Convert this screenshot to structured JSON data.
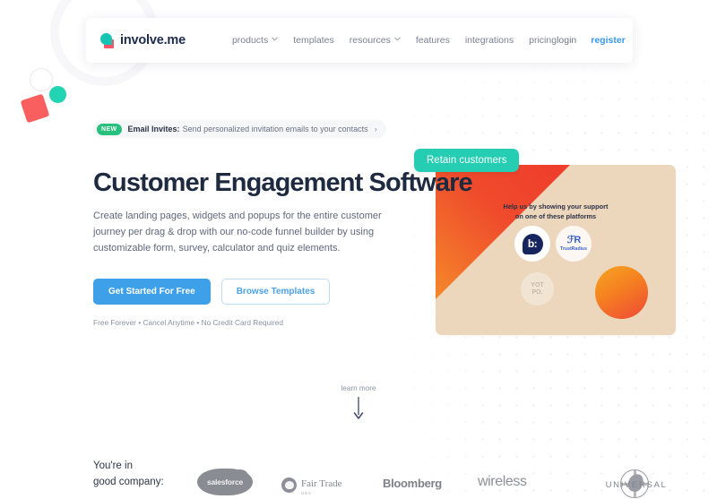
{
  "brand": {
    "name": "involve.me",
    "accent_blue": "#3ea0e8",
    "accent_teal": "#25cdb2",
    "accent_green": "#27c07d",
    "accent_red": "#fa5f5f",
    "heading_color": "#1e2a40"
  },
  "nav": {
    "links": [
      {
        "label": "products",
        "has_caret": true,
        "icon": "chevron-down-icon"
      },
      {
        "label": "templates",
        "has_caret": false
      },
      {
        "label": "resources",
        "has_caret": true,
        "icon": "chevron-down-icon"
      },
      {
        "label": "features",
        "has_caret": false
      },
      {
        "label": "integrations",
        "has_caret": false
      },
      {
        "label": "pricing",
        "has_caret": false
      }
    ],
    "login": "login",
    "register": "register"
  },
  "announcement": {
    "badge": "NEW",
    "strong": "Email Invites:",
    "text": "Send personalized invitation emails to your contacts",
    "arrow": "›"
  },
  "hero": {
    "title": "Customer Engagement Software",
    "subtitle": "Create landing pages, widgets and popups for the entire customer journey per drag & drop with our no-code funnel builder by using customizable form, survey, calculator and quiz elements.",
    "primary_cta": "Get Started For Free",
    "secondary_cta": "Browse Templates",
    "note": "Free Forever • Cancel Anytime • No Credit Card Required"
  },
  "hero_card": {
    "badge": "Retain customers",
    "heading_line1": "Help us by showing your support",
    "heading_line2": "on one of these platforms",
    "platforms": [
      {
        "name": "birdeye",
        "glyph": "b:",
        "icon": "birdeye-logo-icon"
      },
      {
        "name": "TrustRadius",
        "glyph": "ℱR",
        "label": "TrustRadius",
        "icon": "trustradius-logo-icon"
      },
      {
        "name": "Yotpo",
        "line1": "YOT",
        "line2": "PO.",
        "icon": "yotpo-logo-icon"
      }
    ],
    "card_bg": "#ecd7bd",
    "triangle_gradient": [
      "#f5882a",
      "#ef3b2c"
    ],
    "circle_gradient": [
      "#f5a623",
      "#ef4836"
    ]
  },
  "learn_more": {
    "label": "learn more",
    "icon": "arrow-down-icon"
  },
  "company": {
    "label_line1": "You're in",
    "label_line2": "good company:",
    "logos": [
      {
        "name": "salesforce",
        "text": "salesforce",
        "icon": "salesforce-logo-icon"
      },
      {
        "name": "fair-trade",
        "text": "Fair Trade",
        "sub": "USA",
        "icon": "fair-trade-logo-icon"
      },
      {
        "name": "bloomberg",
        "text": "Bloomberg",
        "icon": "bloomberg-logo-icon"
      },
      {
        "name": "wireless",
        "text": "wireless",
        "icon": "wireless-logo-icon"
      },
      {
        "name": "universal",
        "text": "UNIVERSAL",
        "icon": "universal-logo-icon"
      }
    ]
  }
}
